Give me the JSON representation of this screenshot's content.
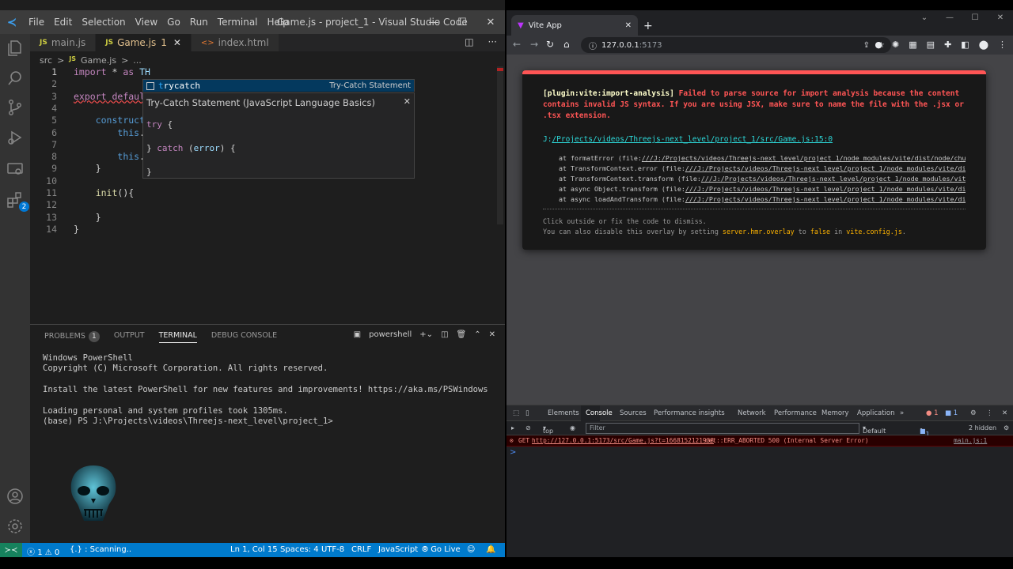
{
  "vscode": {
    "title": "Game.js - project_1 - Visual Studio Code",
    "menu": [
      "File",
      "Edit",
      "Selection",
      "View",
      "Go",
      "Run",
      "Terminal",
      "Help"
    ],
    "activity_badge": "2",
    "tabs": [
      {
        "icon": "JS",
        "label": "main.js",
        "modified": "",
        "active": false
      },
      {
        "icon": "JS",
        "label": "Game.js",
        "modified": "1",
        "active": true
      },
      {
        "icon": "<>",
        "label": "index.html",
        "modified": "",
        "active": false
      }
    ],
    "breadcrumb": [
      "src",
      ">",
      "Game.js",
      ">",
      "..."
    ],
    "code_lines": [
      {
        "n": "1",
        "text": "import * as TH"
      },
      {
        "n": "2",
        "text": ""
      },
      {
        "n": "3",
        "text": "export default"
      },
      {
        "n": "4",
        "text": ""
      },
      {
        "n": "5",
        "text": "    constructo"
      },
      {
        "n": "6",
        "text": "        this.c"
      },
      {
        "n": "7",
        "text": ""
      },
      {
        "n": "8",
        "text": "        this.i"
      },
      {
        "n": "9",
        "text": "    }"
      },
      {
        "n": "10",
        "text": ""
      },
      {
        "n": "11",
        "text": "    init(){"
      },
      {
        "n": "12",
        "text": ""
      },
      {
        "n": "13",
        "text": "    }"
      },
      {
        "n": "14",
        "text": "}"
      }
    ],
    "suggestion": {
      "label": "trycatch",
      "detail": "Try-Catch Statement"
    },
    "suggest_details": {
      "title": "Try-Catch Statement (JavaScript Language Basics)",
      "snippet": "try {\n\n} catch (error) {\n\n}"
    },
    "panel": {
      "tabs": [
        "PROBLEMS",
        "OUTPUT",
        "TERMINAL",
        "DEBUG CONSOLE"
      ],
      "problems_count": "1",
      "shell": "powershell",
      "terminal_lines": [
        "Windows PowerShell",
        "Copyright (C) Microsoft Corporation. All rights reserved.",
        "",
        "Install the latest PowerShell for new features and improvements! https://aka.ms/PSWindows",
        "",
        "Loading personal and system profiles took 1305ms.",
        "(base) PS J:\\Projects\\videos\\Threejs-next_level\\project_1>"
      ]
    },
    "status": {
      "errors": "1",
      "warnings": "0",
      "scanning": "{.} : Scanning..",
      "position": "Ln 1, Col 15",
      "spaces": "Spaces: 4",
      "encoding": "UTF-8",
      "eol": "CRLF",
      "language": "JavaScript",
      "golive": "Go Live"
    }
  },
  "chrome": {
    "tab_title": "Vite App",
    "url_host": "127.0.0.1",
    "url_port": ":5173",
    "overlay": {
      "plugin": "[plugin:vite:import-analysis]",
      "message": "Failed to parse source for import analysis because the content contains invalid JS syntax. If you are using JSX, make sure to name the file with the .jsx or .tsx extension.",
      "file_prefix": "J:",
      "file_link": "/Projects/videos/Threejs-next_level/project_1/src/Game.js:15:0",
      "stack": [
        {
          "pre": "at formatError (file:",
          "link": "///J:/Projects/videos/Threejs-next_level/project_1/node_modules/vite/dist/node/chunks/d"
        },
        {
          "pre": "at TransformContext.error (file:",
          "link": "///J:/Projects/videos/Threejs-next_level/project_1/node_modules/vite/dist/no"
        },
        {
          "pre": "at TransformContext.transform (file:",
          "link": "///J:/Projects/videos/Threejs-next_level/project_1/node_modules/vite/dist/"
        },
        {
          "pre": "at async Object.transform (file:",
          "link": "///J:/Projects/videos/Threejs-next_level/project_1/node_modules/vite/dist/no"
        },
        {
          "pre": "at async loadAndTransform (file:",
          "link": "///J:/Projects/videos/Threejs-next_level/project_1/node_modules/vite/dist/no"
        }
      ],
      "tip1": "Click outside or fix the code to dismiss.",
      "tip2_a": "You can also disable this overlay by setting",
      "tip2_code1": "server.hmr.overlay",
      "tip2_b": "to",
      "tip2_code2": "false",
      "tip2_c": "in",
      "tip2_code3": "vite.config.js",
      "tip2_d": "."
    },
    "devtools": {
      "tabs": [
        "Elements",
        "Console",
        "Sources",
        "Performance insights",
        "Network",
        "Performance",
        "Memory",
        "Application",
        "»"
      ],
      "error_count": "1",
      "info_count": "1",
      "context": "top",
      "filter_placeholder": "Filter",
      "levels": "Default levels",
      "issues": "1 Issue:",
      "issues_count": "1",
      "hidden": "2 hidden",
      "error_method": "GET",
      "error_url": "http://127.0.0.1:5173/src/Game.js?t=1668152121938",
      "error_text": "net::ERR_ABORTED 500 (Internal Server Error)",
      "error_source": "main.js:1",
      "prompt": ">"
    }
  },
  "colors": {
    "accent": "#007acc",
    "error": "#ff5555",
    "link": "#2dd9da"
  }
}
